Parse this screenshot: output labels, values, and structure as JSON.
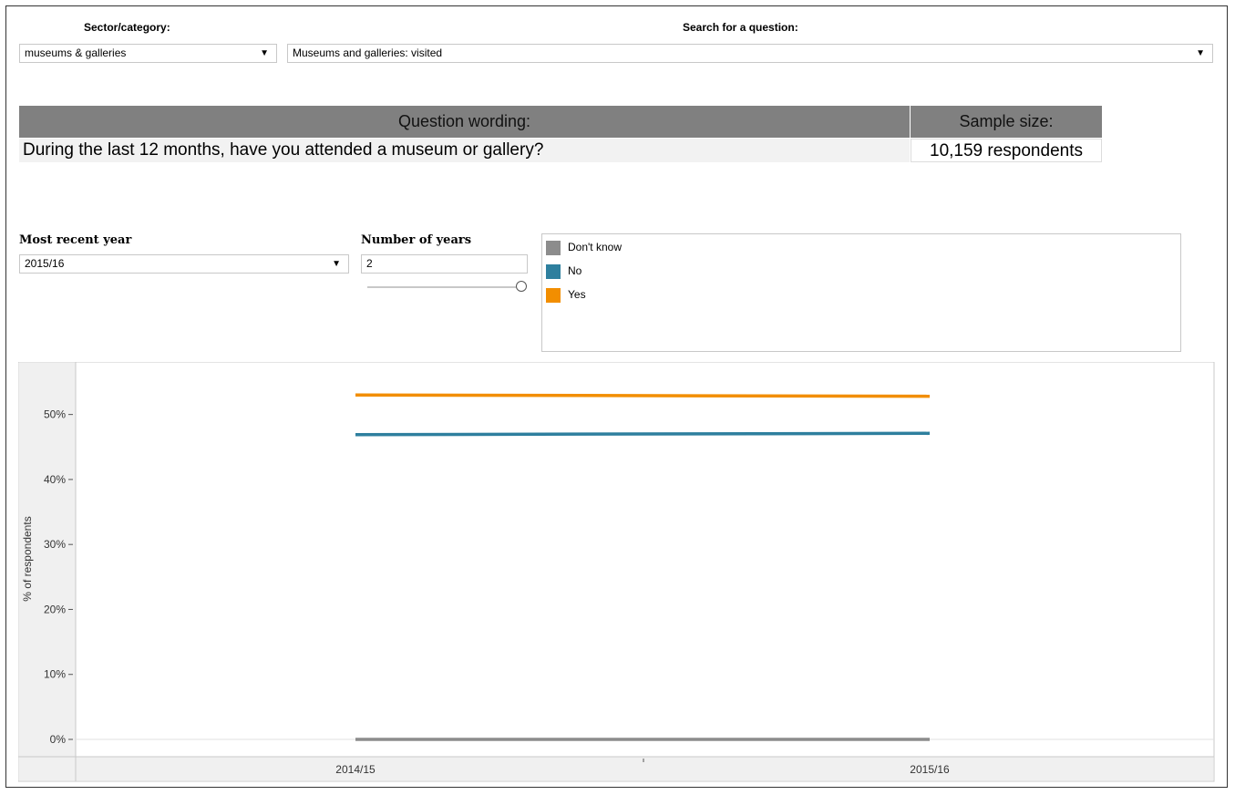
{
  "controls": {
    "sector_label": "Sector/category:",
    "sector_value": "museums & galleries",
    "search_label": "Search for a question:",
    "search_value": "Museums and galleries: visited",
    "year_label": "Most recent year",
    "year_value": "2015/16",
    "numyears_label": "Number of years",
    "numyears_value": "2",
    "numyears_slider": 1.0
  },
  "question": {
    "wording_header": "Question wording:",
    "wording_text": "During the last 12 months, have you attended a museum or gallery?",
    "sample_header": "Sample size:",
    "sample_text": "10,159 respondents"
  },
  "legend": [
    {
      "label": "Don't know",
      "color": "#8c8c8c"
    },
    {
      "label": "No",
      "color": "#2e7f9e"
    },
    {
      "label": "Yes",
      "color": "#f28e00"
    }
  ],
  "chart_data": {
    "type": "line",
    "x": [
      "2014/15",
      "2015/16"
    ],
    "ylabel": "% of respondents",
    "ylim": [
      0,
      55
    ],
    "yticks": [
      "0%",
      "10%",
      "20%",
      "30%",
      "40%",
      "50%"
    ],
    "series": [
      {
        "name": "Yes",
        "color": "#f28e00",
        "values": [
          53.0,
          52.8
        ]
      },
      {
        "name": "No",
        "color": "#2e7f9e",
        "values": [
          46.9,
          47.1
        ]
      },
      {
        "name": "Don't know",
        "color": "#8c8c8c",
        "values": [
          0.0,
          0.0
        ]
      }
    ]
  }
}
